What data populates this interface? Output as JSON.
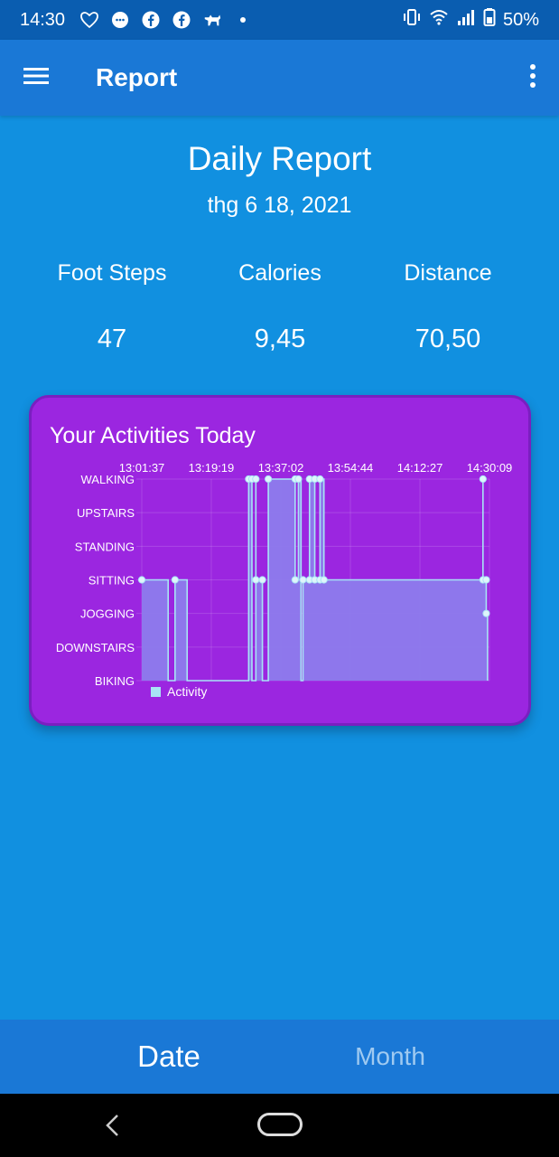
{
  "status_bar": {
    "time": "14:30",
    "battery": "50%",
    "icons": [
      "heart-outline-icon",
      "messenger-icon",
      "facebook-icon",
      "facebook-icon",
      "dog-icon",
      "dot-icon"
    ],
    "right_icons": [
      "vibrate-icon",
      "wifi-icon",
      "signal-icon",
      "battery-icon"
    ]
  },
  "app_bar": {
    "title": "Report",
    "menu_icon": "hamburger-menu-icon",
    "overflow_icon": "more-vert-icon"
  },
  "report": {
    "title": "Daily Report",
    "date": "thg 6 18, 2021"
  },
  "stats": [
    {
      "label": "Foot Steps",
      "value": "47"
    },
    {
      "label": "Calories",
      "value": "9,45"
    },
    {
      "label": "Distance",
      "value": "70,50"
    }
  ],
  "chart_card": {
    "title": "Your Activities Today"
  },
  "chart_data": {
    "type": "line",
    "x_tick_labels": [
      "13:01:37",
      "13:19:19",
      "13:37:02",
      "13:54:44",
      "14:12:27",
      "14:30:09"
    ],
    "y_categories": [
      "WALKING",
      "UPSTAIRS",
      "STANDING",
      "SITTING",
      "JOGGING",
      "DOWNSTAIRS",
      "BIKING"
    ],
    "legend": "Activity",
    "legend_position": "bottom-left",
    "grid": true,
    "series": [
      {
        "name": "Activity",
        "color": "#a8e4f5",
        "fill": "#8d7bec",
        "points": [
          {
            "x": "13:01:37",
            "y": "SITTING",
            "marker": true
          },
          {
            "x": "13:08:20",
            "y": "SITTING",
            "marker": false
          },
          {
            "x": "13:08:20",
            "y": "BIKING",
            "marker": false
          },
          {
            "x": "13:10:05",
            "y": "BIKING",
            "marker": false
          },
          {
            "x": "13:10:05",
            "y": "SITTING",
            "marker": true
          },
          {
            "x": "13:13:10",
            "y": "SITTING",
            "marker": false
          },
          {
            "x": "13:13:10",
            "y": "BIKING",
            "marker": false
          },
          {
            "x": "13:28:50",
            "y": "BIKING",
            "marker": false
          },
          {
            "x": "13:28:50",
            "y": "WALKING",
            "marker": true
          },
          {
            "x": "13:29:40",
            "y": "WALKING",
            "marker": true
          },
          {
            "x": "13:29:40",
            "y": "BIKING",
            "marker": false
          },
          {
            "x": "13:30:40",
            "y": "BIKING",
            "marker": false
          },
          {
            "x": "13:30:40",
            "y": "WALKING",
            "marker": true
          },
          {
            "x": "13:30:40",
            "y": "SITTING",
            "marker": true
          },
          {
            "x": "13:32:20",
            "y": "SITTING",
            "marker": true
          },
          {
            "x": "13:32:20",
            "y": "BIKING",
            "marker": false
          },
          {
            "x": "13:33:50",
            "y": "BIKING",
            "marker": false
          },
          {
            "x": "13:33:50",
            "y": "WALKING",
            "marker": true
          },
          {
            "x": "13:40:40",
            "y": "WALKING",
            "marker": true
          },
          {
            "x": "13:40:40",
            "y": "SITTING",
            "marker": true
          },
          {
            "x": "13:41:30",
            "y": "SITTING",
            "marker": false
          },
          {
            "x": "13:41:30",
            "y": "WALKING",
            "marker": true
          },
          {
            "x": "13:42:10",
            "y": "WALKING",
            "marker": false
          },
          {
            "x": "13:42:10",
            "y": "BIKING",
            "marker": false
          },
          {
            "x": "13:42:40",
            "y": "BIKING",
            "marker": false
          },
          {
            "x": "13:42:40",
            "y": "SITTING",
            "marker": true
          },
          {
            "x": "13:44:20",
            "y": "SITTING",
            "marker": true
          },
          {
            "x": "13:44:20",
            "y": "WALKING",
            "marker": true
          },
          {
            "x": "13:45:40",
            "y": "WALKING",
            "marker": true
          },
          {
            "x": "13:45:40",
            "y": "SITTING",
            "marker": true
          },
          {
            "x": "13:47:00",
            "y": "SITTING",
            "marker": true
          },
          {
            "x": "13:47:00",
            "y": "WALKING",
            "marker": true
          },
          {
            "x": "13:48:00",
            "y": "WALKING",
            "marker": false
          },
          {
            "x": "13:48:00",
            "y": "SITTING",
            "marker": true
          },
          {
            "x": "14:28:30",
            "y": "SITTING",
            "marker": false
          },
          {
            "x": "14:28:30",
            "y": "WALKING",
            "marker": true
          },
          {
            "x": "14:28:30",
            "y": "SITTING",
            "marker": true
          },
          {
            "x": "14:29:20",
            "y": "SITTING",
            "marker": true
          },
          {
            "x": "14:29:20",
            "y": "JOGGING",
            "marker": true
          },
          {
            "x": "14:29:40",
            "y": "JOGGING",
            "marker": false
          },
          {
            "x": "14:29:40",
            "y": "BIKING",
            "marker": false
          }
        ]
      }
    ]
  },
  "tabs": [
    {
      "label": "Date",
      "selected": true
    },
    {
      "label": "Month",
      "selected": false
    }
  ],
  "nav_bar": {
    "icons": [
      "back-icon",
      "home-icon"
    ]
  }
}
